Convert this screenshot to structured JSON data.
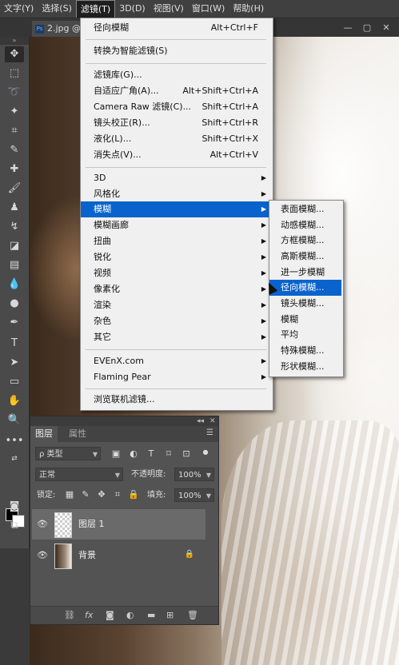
{
  "menubar": {
    "items": [
      {
        "label": "文字(Y)",
        "active": false
      },
      {
        "label": "选择(S)",
        "active": false
      },
      {
        "label": "滤镜(T)",
        "active": true
      },
      {
        "label": "3D(D)",
        "active": false
      },
      {
        "label": "视图(V)",
        "active": false
      },
      {
        "label": "窗口(W)",
        "active": false
      },
      {
        "label": "帮助(H)",
        "active": false
      }
    ]
  },
  "document": {
    "tab_title": "2.jpg @"
  },
  "window_controls": {
    "minimize": "—",
    "restore": "▢",
    "close": "✕"
  },
  "filter_menu": {
    "last_filter": {
      "label": "径向模糊",
      "shortcut": "Alt+Ctrl+F"
    },
    "smart": {
      "label": "转换为智能滤镜(S)"
    },
    "group1": [
      {
        "label": "滤镜库(G)...",
        "shortcut": ""
      },
      {
        "label": "自适应广角(A)...",
        "shortcut": "Alt+Shift+Ctrl+A"
      },
      {
        "label": "Camera Raw 滤镜(C)...",
        "shortcut": "Shift+Ctrl+A"
      },
      {
        "label": "镜头校正(R)...",
        "shortcut": "Shift+Ctrl+R"
      },
      {
        "label": "液化(L)...",
        "shortcut": "Shift+Ctrl+X"
      },
      {
        "label": "消失点(V)...",
        "shortcut": "Alt+Ctrl+V"
      }
    ],
    "group2": [
      {
        "label": "3D",
        "highlighted": false
      },
      {
        "label": "风格化",
        "highlighted": false
      },
      {
        "label": "模糊",
        "highlighted": true
      },
      {
        "label": "模糊画廊",
        "highlighted": false
      },
      {
        "label": "扭曲",
        "highlighted": false
      },
      {
        "label": "锐化",
        "highlighted": false
      },
      {
        "label": "视频",
        "highlighted": false
      },
      {
        "label": "像素化",
        "highlighted": false
      },
      {
        "label": "渲染",
        "highlighted": false
      },
      {
        "label": "杂色",
        "highlighted": false
      },
      {
        "label": "其它",
        "highlighted": false
      }
    ],
    "group3": [
      {
        "label": "EVEnX.com"
      },
      {
        "label": "Flaming Pear"
      }
    ],
    "browse": {
      "label": "浏览联机滤镜..."
    }
  },
  "blur_submenu": [
    {
      "label": "表面模糊...",
      "highlighted": false
    },
    {
      "label": "动感模糊...",
      "highlighted": false
    },
    {
      "label": "方框模糊...",
      "highlighted": false
    },
    {
      "label": "高斯模糊...",
      "highlighted": false
    },
    {
      "label": "进一步模糊",
      "highlighted": false
    },
    {
      "label": "径向模糊...",
      "highlighted": true
    },
    {
      "label": "镜头模糊...",
      "highlighted": false
    },
    {
      "label": "模糊",
      "highlighted": false
    },
    {
      "label": "平均",
      "highlighted": false
    },
    {
      "label": "特殊模糊...",
      "highlighted": false
    },
    {
      "label": "形状模糊...",
      "highlighted": false
    }
  ],
  "layers_panel": {
    "tabs": [
      "图层",
      "属性"
    ],
    "filter_kind": "ρ 类型",
    "blend_mode": "正常",
    "opacity_label": "不透明度:",
    "opacity_value": "100%",
    "lock_label": "锁定:",
    "fill_label": "填充:",
    "fill_value": "100%",
    "layers": [
      {
        "name": "图层 1",
        "selected": true,
        "thumb": "transparent",
        "locked": false
      },
      {
        "name": "背景",
        "selected": false,
        "thumb": "photo",
        "locked": true
      }
    ]
  },
  "colors": {
    "menu_highlight": "#0a63cc",
    "menu_bg": "#f0f0f0",
    "panel_bg": "#535353"
  }
}
